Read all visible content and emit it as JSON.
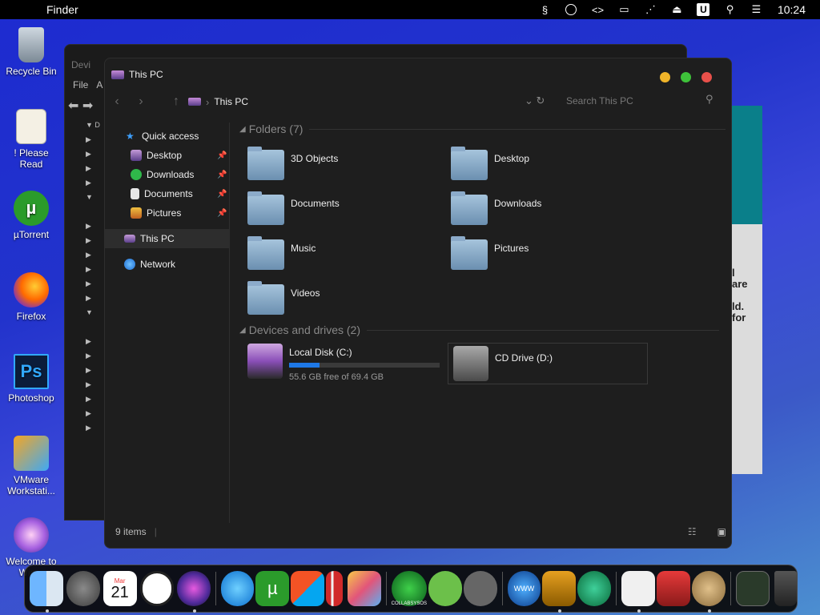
{
  "menubar": {
    "app_name": "Finder",
    "clock": "10:24"
  },
  "desktop_icons": [
    {
      "id": "recycle-bin",
      "label": "Recycle Bin"
    },
    {
      "id": "please-read",
      "label": "! Please Read"
    },
    {
      "id": "utorrent",
      "label": "µTorrent"
    },
    {
      "id": "firefox",
      "label": "Firefox"
    },
    {
      "id": "photoshop",
      "label": "Photoshop",
      "glyph": "Ps"
    },
    {
      "id": "vmware",
      "label": "VMware Workstati..."
    },
    {
      "id": "welcome",
      "label": "Welcome to Win..."
    }
  ],
  "bg_window": {
    "title": "Devi",
    "file_menu": "File",
    "second_menu": "A",
    "tree_first": "D"
  },
  "right_strip_text": "l\nare\n\nld.\nfor",
  "window": {
    "title": "This PC",
    "breadcrumb": "This PC",
    "search_placeholder": "Search This PC",
    "nav": [
      {
        "label": "Quick access",
        "pinned": false
      },
      {
        "label": "Desktop",
        "pinned": true
      },
      {
        "label": "Downloads",
        "pinned": true
      },
      {
        "label": "Documents",
        "pinned": true
      },
      {
        "label": "Pictures",
        "pinned": true
      },
      {
        "label": "This PC",
        "pinned": false,
        "selected": true
      },
      {
        "label": "Network",
        "pinned": false
      }
    ],
    "folders_heading": "Folders (7)",
    "folders": [
      "3D Objects",
      "Desktop",
      "Documents",
      "Downloads",
      "Music",
      "Pictures",
      "Videos"
    ],
    "drives_heading": "Devices and drives (2)",
    "drives": [
      {
        "label": "Local Disk (C:)",
        "free_text": "55.6 GB free of 69.4 GB",
        "used_fraction": 0.2
      },
      {
        "label": "CD Drive (D:)"
      }
    ],
    "status": "9 items"
  },
  "dock": {
    "app_names": [
      "finder",
      "launchpad",
      "calendar",
      "clock",
      "siri",
      "safari",
      "utorrent",
      "windows",
      "parallels",
      "preview",
      "collabsysos",
      "link",
      "utilities",
      "www",
      "downloader",
      "network-app",
      "documents",
      "toolbox",
      "money-bag",
      "terminal",
      "trash"
    ],
    "calendar_month": "Mar",
    "calendar_day": "21",
    "collab_label": "COLLABSYSOS"
  },
  "colors": {
    "close": "#e8504a",
    "minimize": "#f0b429",
    "zoom": "#3ec23a",
    "accent_bar": "#1e78e6"
  }
}
